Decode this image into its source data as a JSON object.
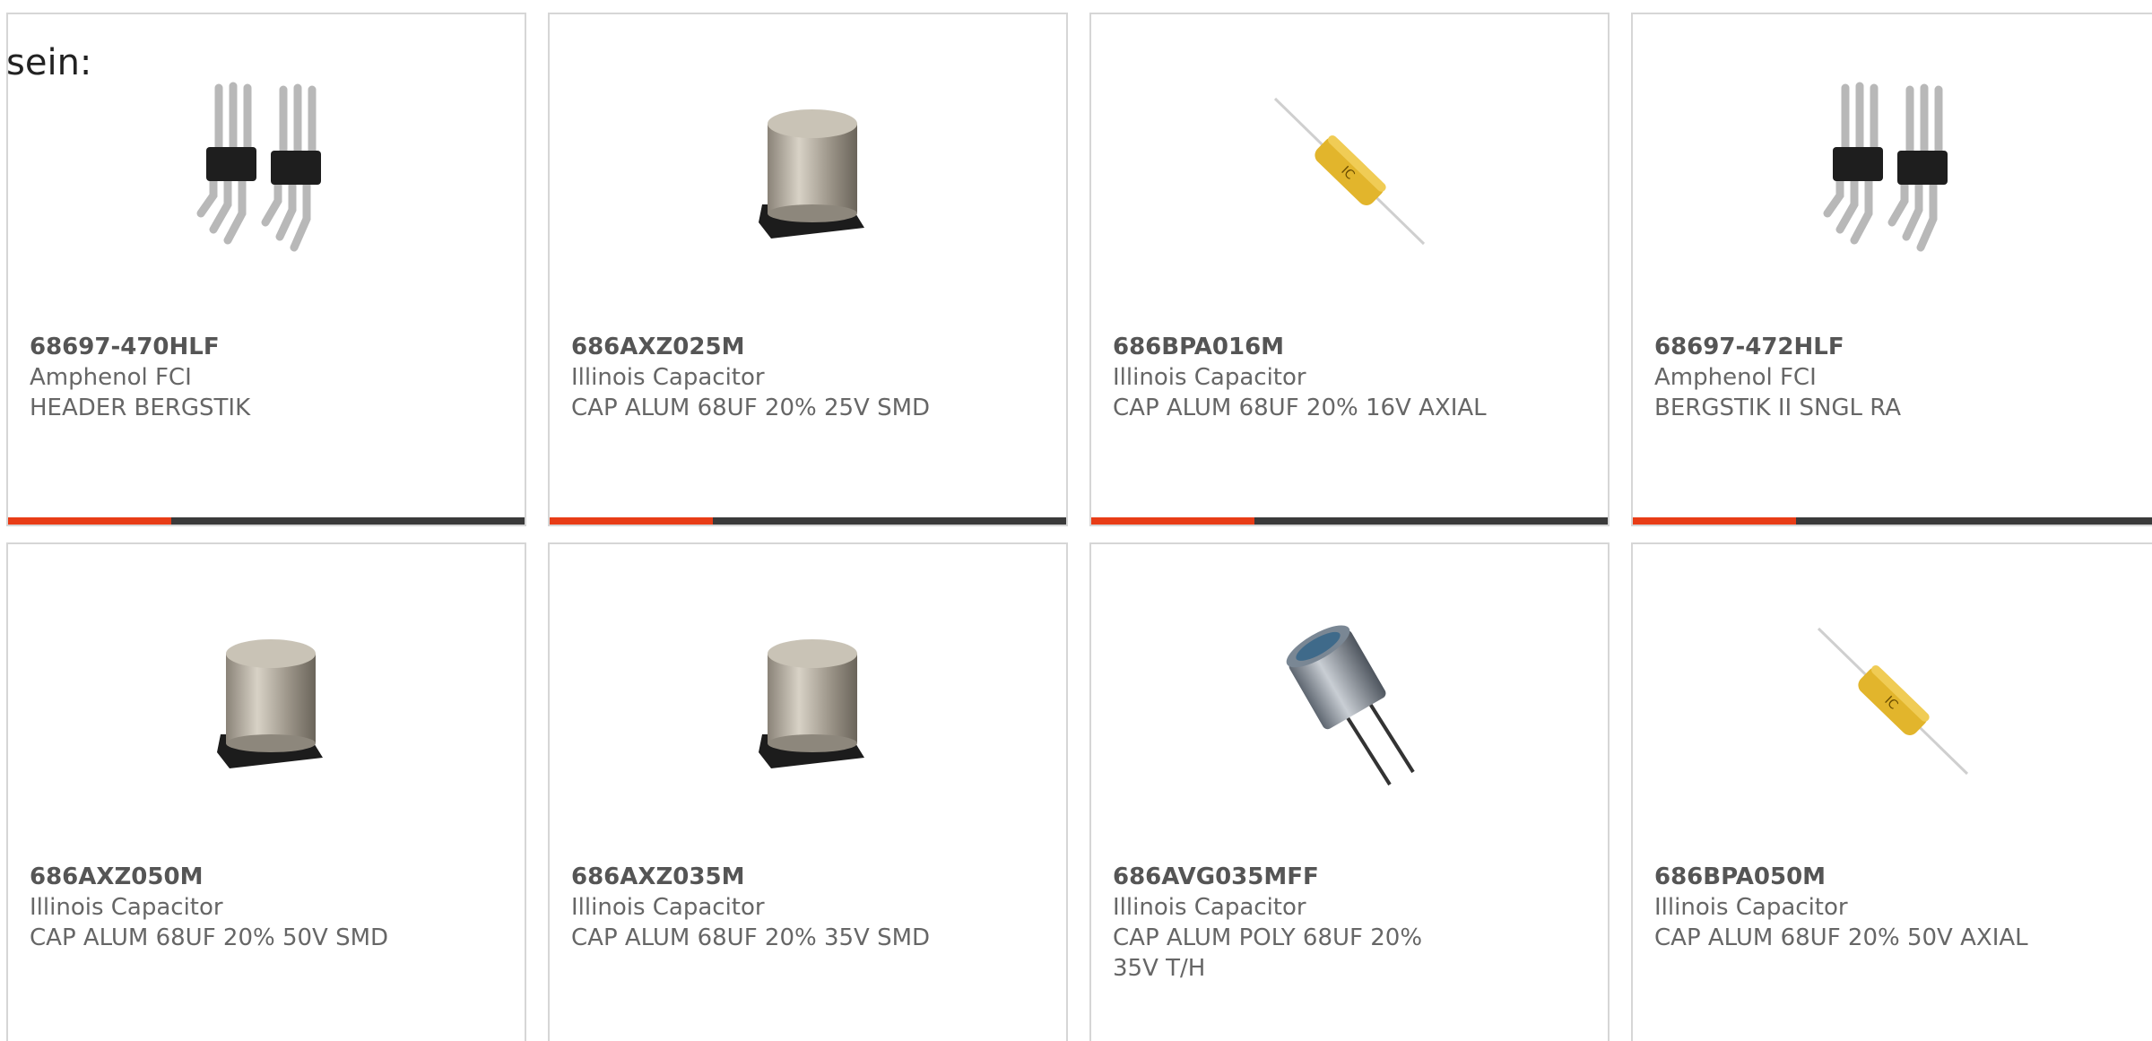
{
  "intro_text": "sein:",
  "colors": {
    "accent": "#e83c16",
    "bar": "#3a3a3a",
    "border": "#d6d6d6",
    "text": "#666666"
  },
  "products": [
    {
      "part_number": "68697-470HLF",
      "manufacturer": "Amphenol FCI",
      "description": "HEADER BERGSTIK",
      "image": "pin-header-image"
    },
    {
      "part_number": "686AXZ025M",
      "manufacturer": "Illinois Capacitor",
      "description": "CAP ALUM 68UF 20% 25V SMD",
      "image": "smd-capacitor-image"
    },
    {
      "part_number": "686BPA016M",
      "manufacturer": "Illinois Capacitor",
      "description": "CAP ALUM 68UF 20% 16V AXIAL",
      "image": "axial-capacitor-image"
    },
    {
      "part_number": "68697-472HLF",
      "manufacturer": "Amphenol FCI",
      "description": "BERGSTIK II SNGL RA",
      "image": "pin-header-image"
    },
    {
      "part_number": "686AXZ050M",
      "manufacturer": "Illinois Capacitor",
      "description": "CAP ALUM 68UF 20% 50V SMD",
      "image": "smd-capacitor-image"
    },
    {
      "part_number": "686AXZ035M",
      "manufacturer": "Illinois Capacitor",
      "description": "CAP ALUM 68UF 20% 35V SMD",
      "image": "smd-capacitor-image"
    },
    {
      "part_number": "686AVG035MFF",
      "manufacturer": "Illinois Capacitor",
      "description": "CAP ALUM POLY 68UF 20% 35V T/H",
      "image": "radial-capacitor-image"
    },
    {
      "part_number": "686BPA050M",
      "manufacturer": "Illinois Capacitor",
      "description": "CAP ALUM 68UF 20% 50V AXIAL",
      "image": "axial-capacitor-image"
    }
  ]
}
